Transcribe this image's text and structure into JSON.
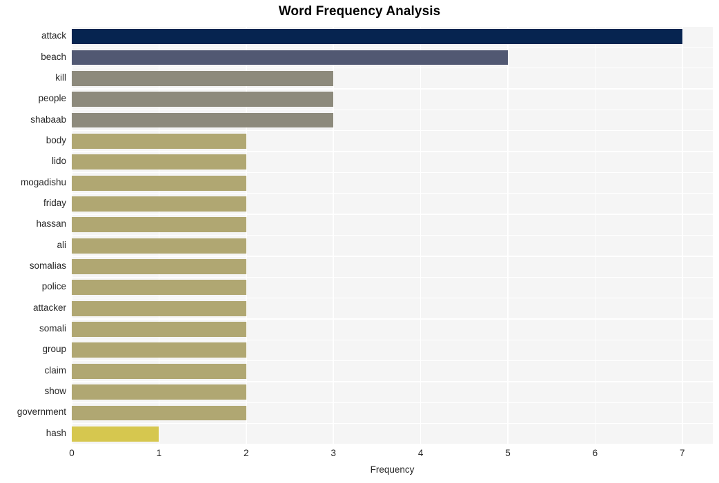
{
  "chart_data": {
    "type": "bar",
    "orientation": "horizontal",
    "title": "Word Frequency Analysis",
    "xlabel": "Frequency",
    "ylabel": "",
    "xlim": [
      0,
      7.35
    ],
    "ylim": [
      0,
      20
    ],
    "grid": true,
    "legend": null,
    "xticks": [
      "0",
      "1",
      "2",
      "3",
      "4",
      "5",
      "6",
      "7"
    ],
    "xtick_values": [
      0,
      1,
      2,
      3,
      4,
      5,
      6,
      7
    ],
    "categories": [
      "attack",
      "beach",
      "kill",
      "people",
      "shabaab",
      "body",
      "lido",
      "mogadishu",
      "friday",
      "hassan",
      "ali",
      "somalias",
      "police",
      "attacker",
      "somali",
      "group",
      "claim",
      "show",
      "government",
      "hash"
    ],
    "values": [
      7,
      5,
      3,
      3,
      3,
      2,
      2,
      2,
      2,
      2,
      2,
      2,
      2,
      2,
      2,
      2,
      2,
      2,
      2,
      1
    ],
    "bar_colors": [
      "#062450",
      "#515872",
      "#8d8a7c",
      "#8d8a7c",
      "#8d8a7c",
      "#b0a772",
      "#b0a772",
      "#b0a772",
      "#b0a772",
      "#b0a772",
      "#b0a772",
      "#b0a772",
      "#b0a772",
      "#b0a772",
      "#b0a772",
      "#b0a772",
      "#b0a772",
      "#b0a772",
      "#b0a772",
      "#d6c74f"
    ],
    "plot_background": "#f5f5f5",
    "figure_background": "#ffffff",
    "gridline_color": "#ffffff",
    "title_color": "#000000",
    "tick_label_color": "#262626"
  }
}
